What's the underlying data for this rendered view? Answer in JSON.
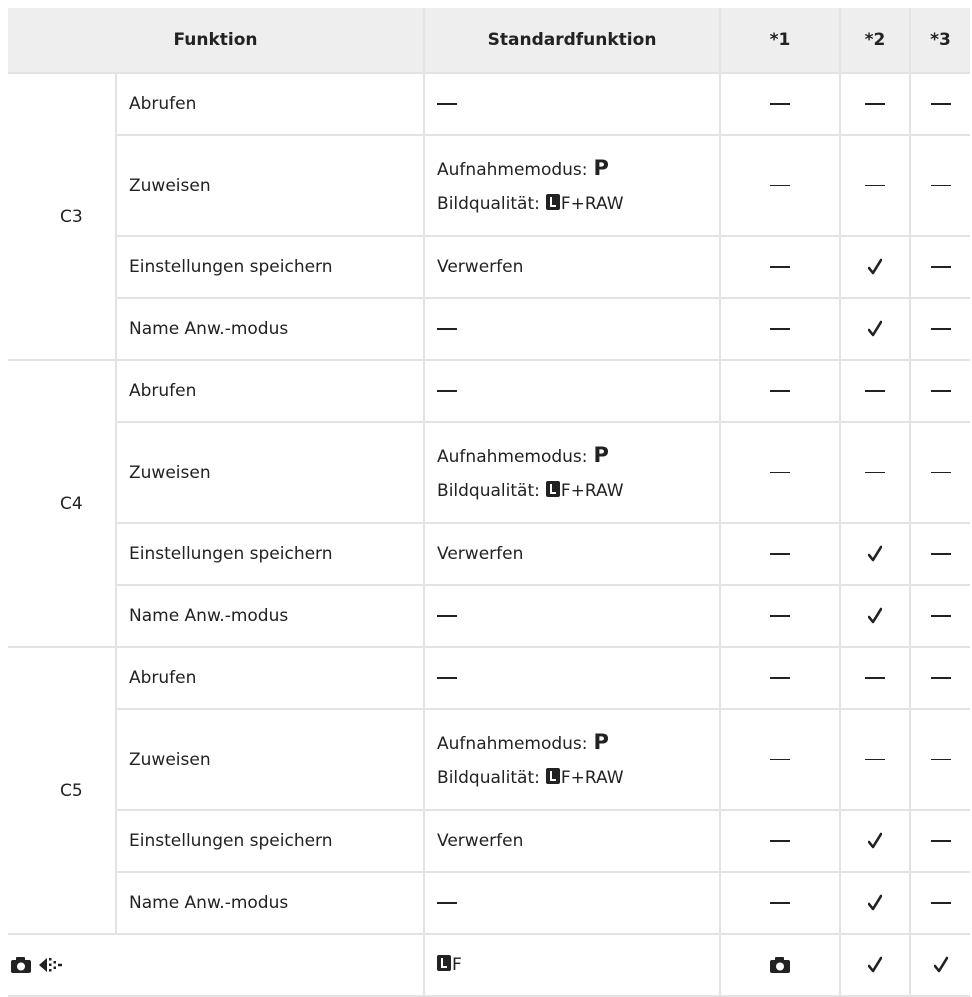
{
  "headers": {
    "funktion": "Funktion",
    "standard": "Standardfunktion",
    "c1": "*1",
    "c2": "*2",
    "c3": "*3"
  },
  "groups": [
    {
      "name": "C3",
      "rows": [
        {
          "label": "Abrufen",
          "default": "dash",
          "c1": "dash",
          "c2": "dash",
          "c3": "dash"
        },
        {
          "label": "Zuweisen",
          "default": "multi",
          "mode_label": "Aufnahmemodus:",
          "mode_value": "P",
          "quality_label": "Bildqualität:",
          "quality_value": "F+RAW",
          "c1": "dash",
          "c2": "dash",
          "c3": "dash"
        },
        {
          "label": "Einstellungen speichern",
          "default": "Verwerfen",
          "c1": "dash",
          "c2": "check",
          "c3": "dash"
        },
        {
          "label": "Name Anw.-modus",
          "default": "dash",
          "c1": "dash",
          "c2": "check",
          "c3": "dash"
        }
      ]
    },
    {
      "name": "C4",
      "rows": [
        {
          "label": "Abrufen",
          "default": "dash",
          "c1": "dash",
          "c2": "dash",
          "c3": "dash"
        },
        {
          "label": "Zuweisen",
          "default": "multi",
          "mode_label": "Aufnahmemodus:",
          "mode_value": "P",
          "quality_label": "Bildqualität:",
          "quality_value": "F+RAW",
          "c1": "dash",
          "c2": "dash",
          "c3": "dash"
        },
        {
          "label": "Einstellungen speichern",
          "default": "Verwerfen",
          "c1": "dash",
          "c2": "check",
          "c3": "dash"
        },
        {
          "label": "Name Anw.-modus",
          "default": "dash",
          "c1": "dash",
          "c2": "check",
          "c3": "dash"
        }
      ]
    },
    {
      "name": "C5",
      "rows": [
        {
          "label": "Abrufen",
          "default": "dash",
          "c1": "dash",
          "c2": "dash",
          "c3": "dash"
        },
        {
          "label": "Zuweisen",
          "default": "multi",
          "mode_label": "Aufnahmemodus:",
          "mode_value": "P",
          "quality_label": "Bildqualität:",
          "quality_value": "F+RAW",
          "c1": "dash",
          "c2": "dash",
          "c3": "dash"
        },
        {
          "label": "Einstellungen speichern",
          "default": "Verwerfen",
          "c1": "dash",
          "c2": "check",
          "c3": "dash"
        },
        {
          "label": "Name Anw.-modus",
          "default": "dash",
          "c1": "dash",
          "c2": "check",
          "c3": "dash"
        }
      ]
    }
  ],
  "last_row": {
    "icons": [
      "camera-icon",
      "image-stabilizer-icon"
    ],
    "default_value": "F",
    "c1": "camera",
    "c2": "check",
    "c3": "check"
  }
}
